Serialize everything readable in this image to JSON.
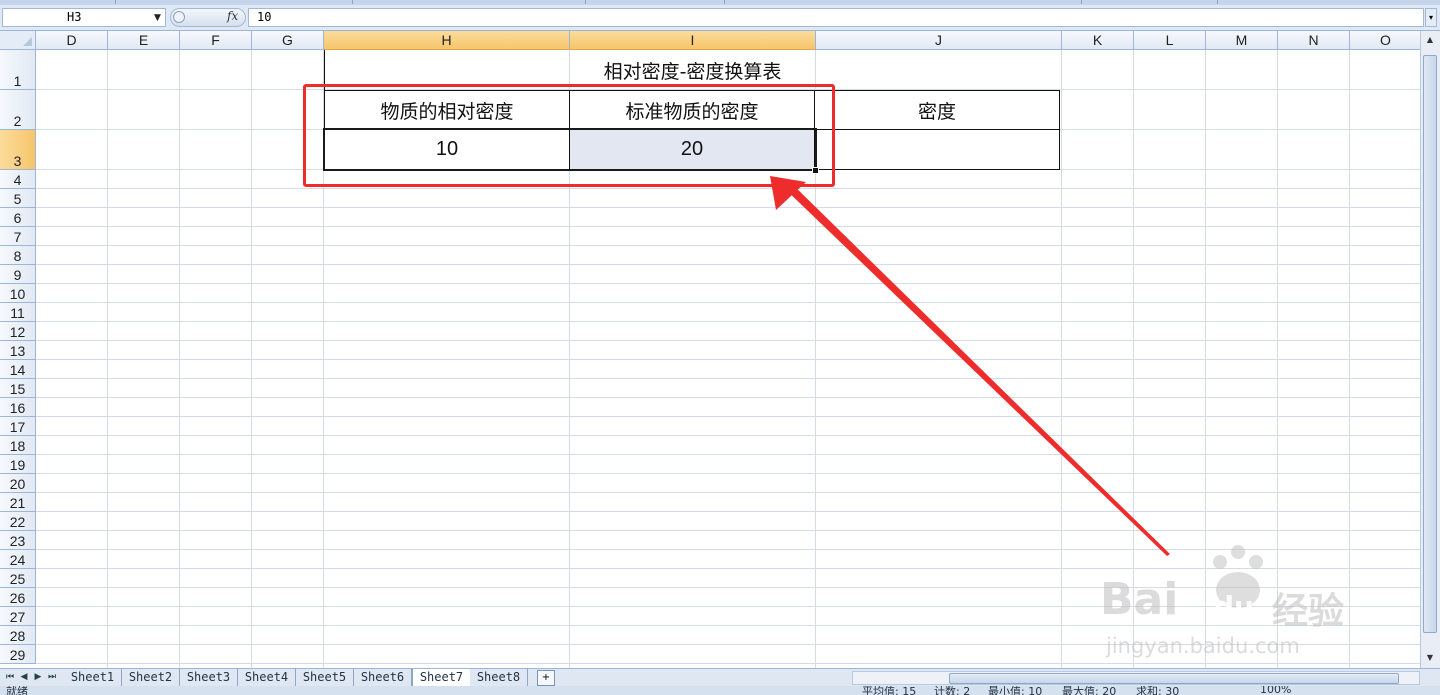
{
  "formula_bar": {
    "name_box": "H3",
    "fx_label": "fx",
    "formula_value": "10"
  },
  "columns": [
    "D",
    "E",
    "F",
    "G",
    "H",
    "I",
    "J",
    "K",
    "L",
    "M",
    "N",
    "O"
  ],
  "rows": [
    "1",
    "2",
    "3",
    "4",
    "5",
    "6",
    "7",
    "8",
    "9",
    "10",
    "11",
    "12",
    "13",
    "14",
    "15",
    "16",
    "17",
    "18",
    "19",
    "20",
    "21",
    "22",
    "23",
    "24",
    "25",
    "26",
    "27",
    "28",
    "29"
  ],
  "table": {
    "title": "相对密度-密度换算表",
    "header_relative_density": "物质的相对密度",
    "header_standard_density": "标准物质的密度",
    "header_density": "密度",
    "value_relative_density": "10",
    "value_standard_density": "20",
    "value_density": ""
  },
  "sheet_tabs": [
    "Sheet1",
    "Sheet2",
    "Sheet3",
    "Sheet4",
    "Sheet5",
    "Sheet6",
    "Sheet7",
    "Sheet8"
  ],
  "active_tab": "Sheet7",
  "status": {
    "ready": "就绪",
    "average": "平均值: 15",
    "count": "计数: 2",
    "min": "最小值: 10",
    "max": "最大值: 20",
    "sum": "求和: 30",
    "zoom": "100%"
  },
  "watermark": {
    "brand": "Bai",
    "brand_du": "du",
    "cn": "经验",
    "url": "jingyan.baidu.com"
  },
  "colors": {
    "annotation_red": "#ee2c2c",
    "selected_header": "#f6c56b",
    "grid": "#d4dbe6"
  }
}
